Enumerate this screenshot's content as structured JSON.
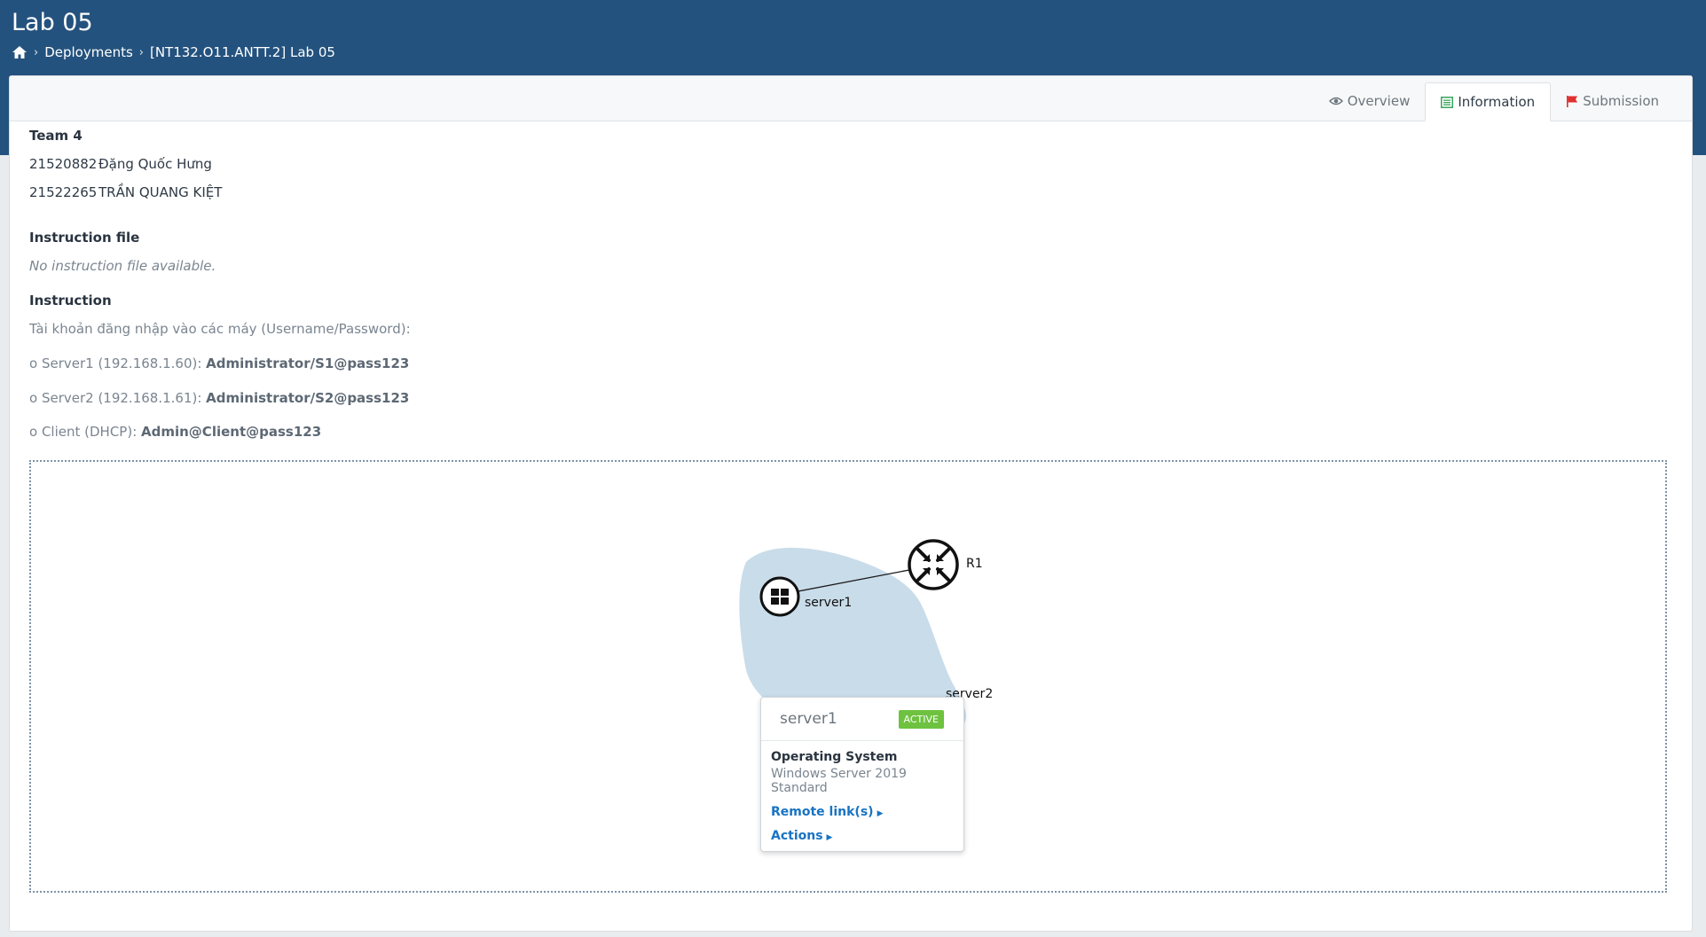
{
  "header": {
    "title": "Lab 05",
    "breadcrumb": [
      "Deployments",
      "[NT132.O11.ANTT.2] Lab 05"
    ]
  },
  "tabs": [
    {
      "label": "Overview",
      "icon": "eye-icon",
      "active": false
    },
    {
      "label": "Information",
      "icon": "list-icon",
      "active": true,
      "color": "#3aa55d"
    },
    {
      "label": "Submission",
      "icon": "flag-icon",
      "active": false,
      "color": "#e0312f"
    }
  ],
  "team": {
    "heading": "Team 4",
    "members": [
      {
        "id": "21520882",
        "name": "Đặng Quốc Hưng"
      },
      {
        "id": "21522265",
        "name": "TRẦN QUANG KIỆT"
      }
    ]
  },
  "instruction_file": {
    "heading": "Instruction file",
    "text": "No instruction file available."
  },
  "instruction": {
    "heading": "Instruction",
    "intro": "Tài khoản đăng nhập vào các máy (Username/Password):",
    "lines": [
      {
        "label": "o Server1 (192.168.1.60): ",
        "value": "Administrator/S1@pass123"
      },
      {
        "label": "o Server2 (192.168.1.61): ",
        "value": "Administrator/S2@pass123"
      },
      {
        "label": "o Client (DHCP): ",
        "value": "Admin@Client@pass123"
      }
    ]
  },
  "topology": {
    "nodes": [
      {
        "label": "server1",
        "icon": "windows-icon"
      },
      {
        "label": "R1",
        "icon": "router-icon"
      },
      {
        "label": "server2",
        "icon": "windows-icon"
      }
    ],
    "popup": {
      "name": "server1",
      "status": "ACTIVE",
      "os_label": "Operating System",
      "os_value": "Windows Server 2019 Standard",
      "remote_links": "Remote link(s)",
      "actions": "Actions"
    },
    "colors": {
      "network_blob": "#c9dcea",
      "status_active": "#6ec240",
      "link": "#1873c3"
    }
  }
}
